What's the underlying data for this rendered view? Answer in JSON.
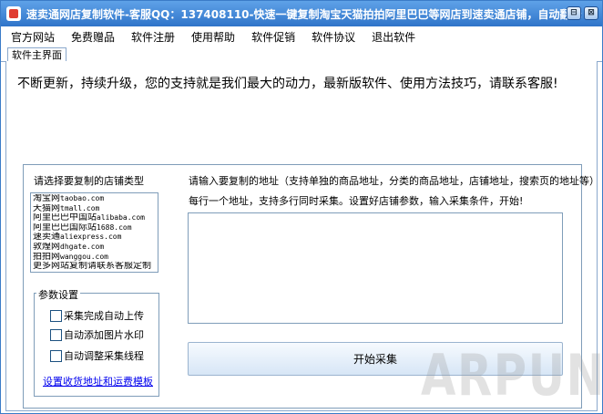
{
  "window": {
    "title": "速卖通网店复制软件-客服QQ：137408110-快速一键复制淘宝天猫拍拍阿里巴巴等网店到速卖通店铺，自动翻译",
    "minimize_label": "⊟",
    "close_label": "⊠"
  },
  "menu": {
    "items": [
      "官方网站",
      "免费赠品",
      "软件注册",
      "使用帮助",
      "软件促销",
      "软件协议",
      "退出软件"
    ]
  },
  "tabs": [
    "软件主界面"
  ],
  "banner": "不断更新，持续升级，您的支持就是我们最大的动力，最新版软件、使用方法技巧，请联系客服!",
  "store": {
    "label": "请选择要复制的店铺类型",
    "items": [
      {
        "name": "淘宝网",
        "url": "taobao.com"
      },
      {
        "name": "天猫网",
        "url": "tmall.com"
      },
      {
        "name": "阿里巴巴中国站",
        "url": "alibaba.com"
      },
      {
        "name": "阿里巴巴国际站",
        "url": "1688.com"
      },
      {
        "name": "速卖通",
        "url": "aliexpress.com"
      },
      {
        "name": "敦煌网",
        "url": "dhgate.com"
      },
      {
        "name": "拍拍网",
        "url": "wanggou.com"
      },
      {
        "name": "更多网站复制请联系客服定制",
        "url": ""
      }
    ]
  },
  "params": {
    "legend": "参数设置",
    "options": [
      "采集完成自动上传",
      "自动添加图片水印",
      "自动调整采集线程"
    ],
    "link": "设置收货地址和运费模板"
  },
  "main": {
    "instruction1": "请输入要复制的地址（支持单独的商品地址，分类的商品地址，店铺地址，搜索页的地址等）",
    "instruction2": "每行一个地址，支持多行同时采集。设置好店铺参数，输入采集条件，开始!",
    "url_value": "",
    "start_button": "开始采集"
  },
  "watermark": "ARPUN"
}
